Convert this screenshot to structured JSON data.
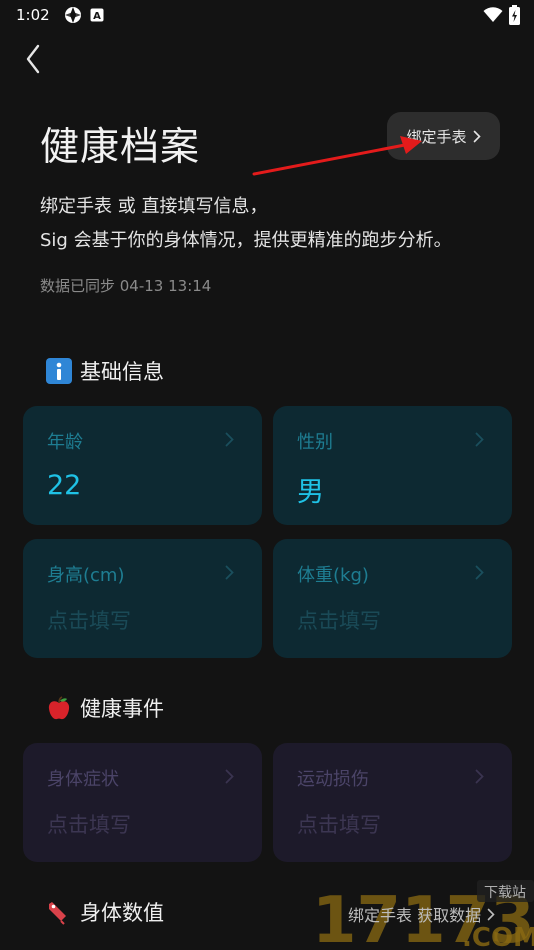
{
  "status_bar": {
    "time": "1:02"
  },
  "header": {
    "title": "健康档案",
    "bind_watch_label": "绑定手表"
  },
  "intro": {
    "line1": "绑定手表 或 直接填写信息，",
    "line2": "Sig 会基于你的身体情况，提供更精准的跑步分析。",
    "sync_status": "数据已同步 04-13 13:14"
  },
  "sections": {
    "basic": {
      "title": "基础信息",
      "icon": "info-icon",
      "cards": [
        {
          "label": "年龄",
          "value": "22"
        },
        {
          "label": "性别",
          "value": "男"
        },
        {
          "label": "身高(cm)",
          "value": "点击填写"
        },
        {
          "label": "体重(kg)",
          "value": "点击填写"
        }
      ]
    },
    "health_events": {
      "title": "健康事件",
      "icon": "apple-icon",
      "cards": [
        {
          "label": "身体症状",
          "value": "点击填写"
        },
        {
          "label": "运动损伤",
          "value": "点击填写"
        }
      ]
    },
    "body_metrics": {
      "title": "身体数值",
      "icon": "bookmark-icon",
      "bind_link": "绑定手表 获取数据"
    }
  },
  "watermark": {
    "brand": "17173",
    "domain": ".COM",
    "tag": "下载站"
  },
  "colors": {
    "background": "#131313",
    "teal_card": "#0d2932",
    "purple_card": "#1d1a2a",
    "accent": "#1fc2e6",
    "annotation_arrow": "#e31b1b"
  }
}
